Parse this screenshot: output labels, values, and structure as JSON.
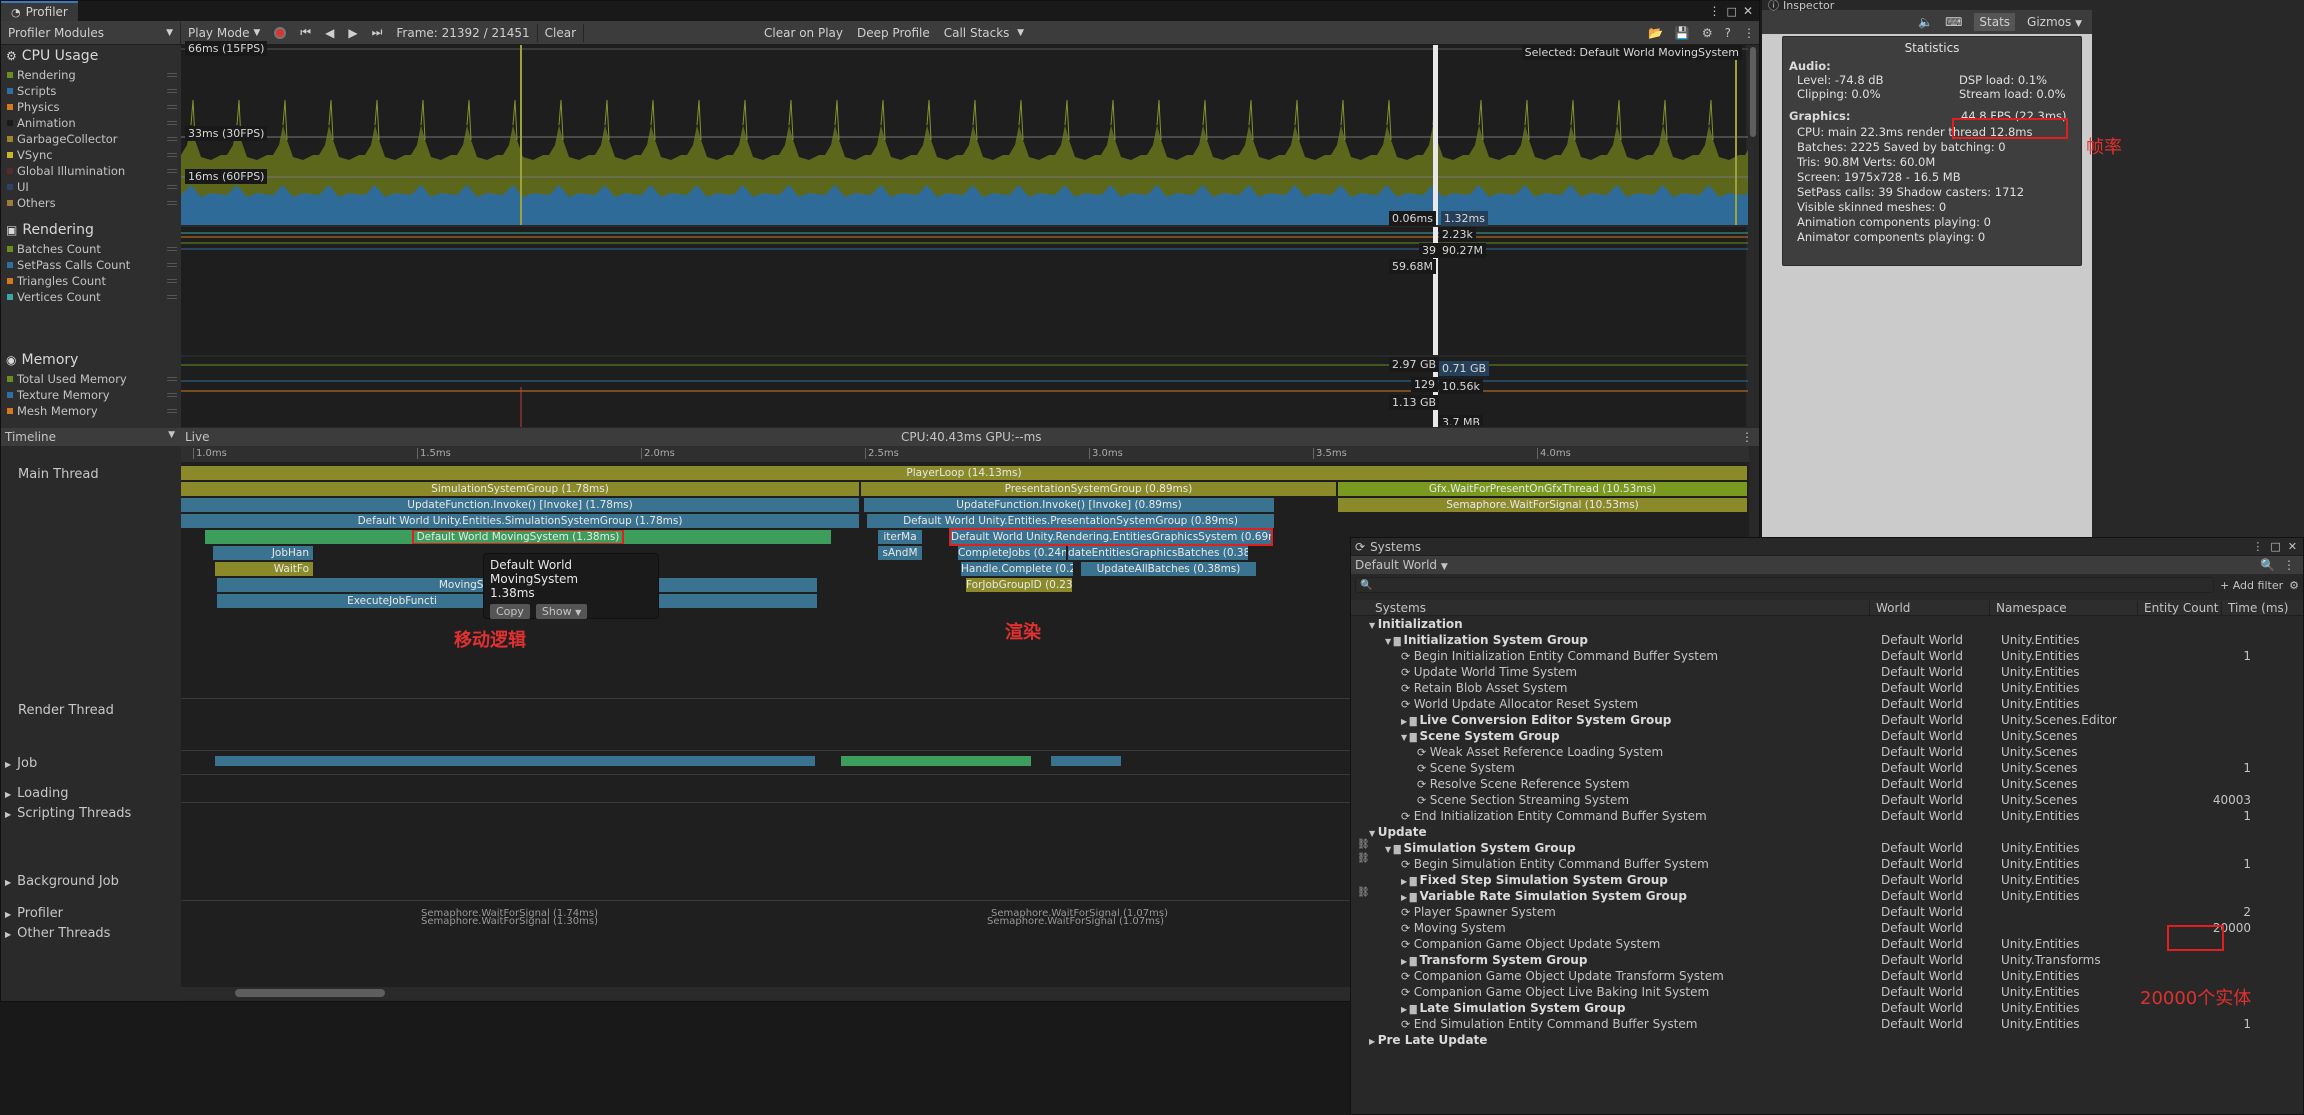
{
  "window": {
    "tab": "Profiler"
  },
  "toolbar": {
    "modules": "Profiler Modules",
    "mode": "Play Mode",
    "frame": "Frame: 21392 / 21451",
    "clear": "Clear",
    "clear_on_play": "Clear on Play",
    "deep_profile": "Deep Profile",
    "call_stacks": "Call Stacks"
  },
  "cpu": {
    "title": "CPU Usage",
    "legend": [
      "Rendering",
      "Scripts",
      "Physics",
      "Animation",
      "GarbageCollector",
      "VSync",
      "Global Illumination",
      "UI",
      "Others"
    ],
    "legend_colors": [
      "#6b8e23",
      "#2f6f9f",
      "#d47a1c",
      "#1a1a1a",
      "#a0862a",
      "#c9b62a",
      "#5a2a2a",
      "#2f3f6f",
      "#a07a3a"
    ],
    "ms66": "66ms (15FPS)",
    "ms33": "33ms (30FPS)",
    "ms16": "16ms (60FPS)",
    "selected": "Selected: Default World MovingSystem",
    "val1": "0.06ms",
    "val2": "1.32ms"
  },
  "rendering": {
    "title": "Rendering",
    "legend": [
      "Batches Count",
      "SetPass Calls Count",
      "Triangles Count",
      "Vertices Count"
    ],
    "legend_colors": [
      "#6b8e23",
      "#2f6f9f",
      "#d47a1c",
      "#3aa6a6"
    ],
    "v1": "2.23k",
    "v2": "39",
    "v3": "90.27M",
    "v4": "59.68M"
  },
  "memory": {
    "title": "Memory",
    "legend": [
      "Total Used Memory",
      "Texture Memory",
      "Mesh Memory"
    ],
    "legend_colors": [
      "#6b8e23",
      "#2f6f9f",
      "#d47a1c"
    ],
    "v1": "2.97 GB",
    "v2": "0.71 GB",
    "v3": "129",
    "v4": "10.56k",
    "v5": "1.13 GB",
    "v6": "3.7 MB"
  },
  "timeline": {
    "label": "Timeline",
    "live": "Live",
    "cpu_gpu": "CPU:40.43ms   GPU:--ms",
    "ticks": [
      "1.0ms",
      "1.5ms",
      "2.0ms",
      "2.5ms",
      "3.0ms",
      "3.5ms",
      "4.0ms"
    ]
  },
  "threads": {
    "main": "Main Thread",
    "render": "Render Thread",
    "job": "Job",
    "loading": "Loading",
    "scripting": "Scripting Threads",
    "background": "Background Job",
    "profiler": "Profiler",
    "other": "Other Threads"
  },
  "bars": {
    "playerloop": "PlayerLoop (14.13ms)",
    "simgroup": "SimulationSystemGroup (1.78ms)",
    "presgroup": "PresentationSystemGroup (0.89ms)",
    "gfxwait": "Gfx.WaitForPresentOnGfxThread (10.53ms)",
    "invoke1": "UpdateFunction.Invoke() [Invoke] (1.78ms)",
    "invoke2": "UpdateFunction.Invoke() [Invoke] (0.89ms)",
    "semaphore": "Semaphore.WaitForSignal (10.53ms)",
    "dw_sim": "Default World Unity.Entities.SimulationSystemGroup (1.78ms)",
    "dw_pres": "Default World Unity.Entities.PresentationSystemGroup (0.89ms)",
    "moving": "Default World MovingSystem (1.38ms)",
    "graphics": "Default World Unity.Rendering.EntitiesGraphicsSystem (0.69ms)",
    "jobhan": "JobHan",
    "waitfo": "WaitFo",
    "movingsys": "MovingSys",
    "executejob": "ExecuteJobFuncti",
    "completejobs": "CompleteJobs (0.24ms",
    "updatebatches": "dateEntitiesGraphicsBatches (0.38r",
    "handle": "Handle.Complete (0.24",
    "updateall": "UpdateAllBatches (0.38ms)",
    "forjob": "ForJobGroupID (0.23",
    "iterma": "iterMa",
    "sandm": "sAndM",
    "sema1": "Semaphore.WaitForSignal (1.74ms)",
    "sema2": "Semaphore.WaitForSignal (1.07ms)",
    "sema3": "Semaphore.WaitForSignal (1.30ms)",
    "sema4": "Semaphore.WaitForSignal (1.07ms)"
  },
  "tooltip": {
    "title": "Default World MovingSystem",
    "time": "1.38ms",
    "copy": "Copy",
    "show": "Show"
  },
  "annotations": {
    "moving": "移动逻辑",
    "render": "渲染",
    "fps": "帧率",
    "entities": "20000个实体"
  },
  "inspector": {
    "tab": "Inspector",
    "stats_btn": "Stats",
    "gizmos": "Gizmos"
  },
  "stats": {
    "title": "Statistics",
    "audio": "Audio:",
    "level": "Level: -74.8 dB",
    "clipping": "Clipping: 0.0%",
    "dsp": "DSP load: 0.1%",
    "stream": "Stream load: 0.0%",
    "graphics": "Graphics:",
    "fps": "44.8 FPS (22.3ms)",
    "cpu": "CPU: main 22.3ms  render thread 12.8ms",
    "batches": "Batches: 2225   Saved by batching: 0",
    "tris": "Tris: 90.8M        Verts: 60.0M",
    "screen": "Screen: 1975x728 - 16.5 MB",
    "setpass": "SetPass calls: 39      Shadow casters: 1712",
    "skinned": "Visible skinned meshes: 0",
    "anim": "Animation components playing: 0",
    "animator": "Animator components playing: 0"
  },
  "systems": {
    "tab": "Systems",
    "world": "Default World",
    "add_filter": "+ Add filter",
    "cols": [
      "Systems",
      "World",
      "Namespace",
      "Entity Count",
      "Time (ms)"
    ],
    "rows": [
      {
        "name": "Initialization",
        "world": "",
        "ns": "",
        "count": "",
        "lvl": 0,
        "kind": "root"
      },
      {
        "name": "Initialization System Group",
        "world": "Default World",
        "ns": "Unity.Entities",
        "count": "",
        "lvl": 1,
        "kind": "group"
      },
      {
        "name": "Begin Initialization Entity Command Buffer System",
        "world": "Default World",
        "ns": "Unity.Entities",
        "count": "1",
        "lvl": 2,
        "kind": "sys"
      },
      {
        "name": "Update World Time System",
        "world": "Default World",
        "ns": "Unity.Entities",
        "count": "",
        "lvl": 2,
        "kind": "sys"
      },
      {
        "name": "Retain Blob Asset System",
        "world": "Default World",
        "ns": "Unity.Entities",
        "count": "",
        "lvl": 2,
        "kind": "sys"
      },
      {
        "name": "World Update Allocator Reset System",
        "world": "Default World",
        "ns": "Unity.Entities",
        "count": "",
        "lvl": 2,
        "kind": "sys"
      },
      {
        "name": "Live Conversion Editor System Group",
        "world": "Default World",
        "ns": "Unity.Scenes.Editor",
        "count": "",
        "lvl": 2,
        "kind": "group"
      },
      {
        "name": "Scene System Group",
        "world": "Default World",
        "ns": "Unity.Scenes",
        "count": "",
        "lvl": 2,
        "kind": "group"
      },
      {
        "name": "Weak Asset Reference Loading System",
        "world": "Default World",
        "ns": "Unity.Scenes",
        "count": "",
        "lvl": 3,
        "kind": "sys"
      },
      {
        "name": "Scene System",
        "world": "Default World",
        "ns": "Unity.Scenes",
        "count": "1",
        "lvl": 3,
        "kind": "sys"
      },
      {
        "name": "Resolve Scene Reference System",
        "world": "Default World",
        "ns": "Unity.Scenes",
        "count": "",
        "lvl": 3,
        "kind": "sys"
      },
      {
        "name": "Scene Section Streaming System",
        "world": "Default World",
        "ns": "Unity.Scenes",
        "count": "40003",
        "lvl": 3,
        "kind": "sys"
      },
      {
        "name": "End Initialization Entity Command Buffer System",
        "world": "Default World",
        "ns": "Unity.Entities",
        "count": "1",
        "lvl": 2,
        "kind": "sys"
      },
      {
        "name": "Update",
        "world": "",
        "ns": "",
        "count": "",
        "lvl": 0,
        "kind": "root"
      },
      {
        "name": "Simulation System Group",
        "world": "Default World",
        "ns": "Unity.Entities",
        "count": "",
        "lvl": 1,
        "kind": "group"
      },
      {
        "name": "Begin Simulation Entity Command Buffer System",
        "world": "Default World",
        "ns": "Unity.Entities",
        "count": "1",
        "lvl": 2,
        "kind": "sys"
      },
      {
        "name": "Fixed Step Simulation System Group",
        "world": "Default World",
        "ns": "Unity.Entities",
        "count": "",
        "lvl": 2,
        "kind": "group"
      },
      {
        "name": "Variable Rate Simulation System Group",
        "world": "Default World",
        "ns": "Unity.Entities",
        "count": "",
        "lvl": 2,
        "kind": "group"
      },
      {
        "name": "Player Spawner System",
        "world": "Default World",
        "ns": "",
        "count": "2",
        "lvl": 2,
        "kind": "sys"
      },
      {
        "name": "Moving System",
        "world": "Default World",
        "ns": "",
        "count": "20000",
        "lvl": 2,
        "kind": "sys"
      },
      {
        "name": "Companion Game Object Update System",
        "world": "Default World",
        "ns": "Unity.Entities",
        "count": "",
        "lvl": 2,
        "kind": "sys"
      },
      {
        "name": "Transform System Group",
        "world": "Default World",
        "ns": "Unity.Transforms",
        "count": "",
        "lvl": 2,
        "kind": "group"
      },
      {
        "name": "Companion Game Object Update Transform System",
        "world": "Default World",
        "ns": "Unity.Entities",
        "count": "",
        "lvl": 2,
        "kind": "sys"
      },
      {
        "name": "Companion Game Object Live Baking Init System",
        "world": "Default World",
        "ns": "Unity.Entities",
        "count": "",
        "lvl": 2,
        "kind": "sys"
      },
      {
        "name": "Late Simulation System Group",
        "world": "Default World",
        "ns": "Unity.Entities",
        "count": "",
        "lvl": 2,
        "kind": "group"
      },
      {
        "name": "End Simulation Entity Command Buffer System",
        "world": "Default World",
        "ns": "Unity.Entities",
        "count": "1",
        "lvl": 2,
        "kind": "sys"
      },
      {
        "name": "Pre Late Update",
        "world": "",
        "ns": "",
        "count": "",
        "lvl": 0,
        "kind": "root"
      }
    ]
  }
}
